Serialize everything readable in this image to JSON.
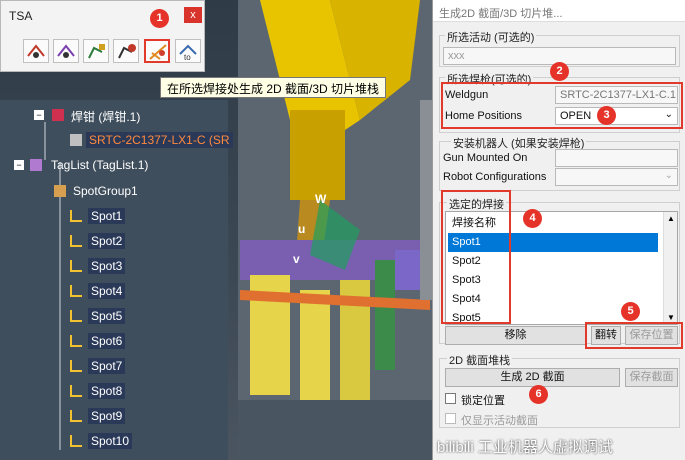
{
  "toolbar": {
    "title": "TSA",
    "close_label": "x",
    "buttons": [
      "spot-weld-icon",
      "spot-weld-alt-icon",
      "robot-reach-icon",
      "robot-gun-icon",
      "section-pile-icon",
      "projection-icon"
    ]
  },
  "tooltip": "在所选焊接处生成 2D 截面/3D 切片堆栈",
  "markers": [
    "1",
    "2",
    "3",
    "4",
    "5",
    "6"
  ],
  "tree": {
    "gun_node": "焊钳 (焊钳.1)",
    "gun_instance": "SRTC-2C1377-LX1-C (SR",
    "taglist": "TagList (TagList.1)",
    "spotgroup": "SpotGroup1",
    "spots": [
      "Spot1",
      "Spot2",
      "Spot3",
      "Spot4",
      "Spot5",
      "Spot6",
      "Spot7",
      "Spot8",
      "Spot9",
      "Spot10"
    ]
  },
  "viewport": {
    "labels": [
      "W",
      "u",
      "v"
    ]
  },
  "dialog": {
    "title": "生成2D 截面/3D 切片堆...",
    "activity_group": "所选活动 (可选的)",
    "activity_value": "xxx",
    "gun_group": "所选焊枪(可选的)",
    "weldgun_label": "Weldgun",
    "weldgun_value": "SRTC-2C1377-LX1-C.1",
    "home_label": "Home Positions",
    "home_value": "OPEN",
    "robot_group": "安装机器人 (如果安装焊枪)",
    "gun_mounted_label": "Gun Mounted On",
    "robot_config_label": "Robot Configurations",
    "welds_group": "选定的焊接",
    "list_header": "焊接名称",
    "welds": [
      "Spot1",
      "Spot2",
      "Spot3",
      "Spot4",
      "Spot5"
    ],
    "remove_btn": "移除",
    "flip_btn": "翻转",
    "save_pos_btn": "保存位置",
    "stack_group": "2D 截面堆栈",
    "generate_btn": "生成 2D 截面",
    "save_section_btn": "保存截面",
    "lock_label": "锁定位置",
    "show_active_label": "仅显示活动截面"
  },
  "watermark": "bilibili 工业机器人虚拟调试"
}
